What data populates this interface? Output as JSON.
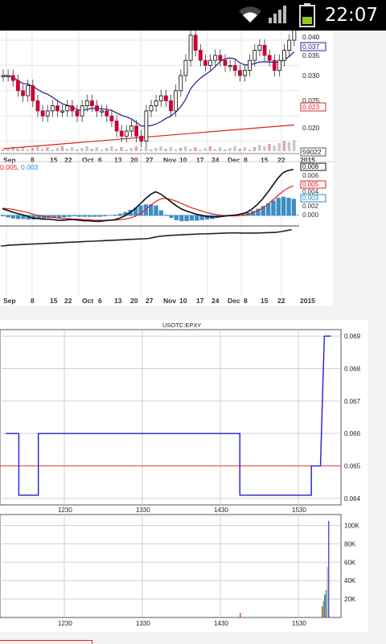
{
  "status_bar": {
    "time": "22:07",
    "icons": [
      "wifi-icon",
      "signal-icon",
      "battery-icon"
    ]
  },
  "chart_data": [
    {
      "type": "line",
      "subtype": "candlestick-with-moving-averages",
      "price_ticks": [
        "0.040",
        "0.035",
        "0.030",
        "0.025",
        "0.020"
      ],
      "last_price_labels": [
        "0.037",
        "0.023"
      ],
      "volume_label": "59022",
      "date_ticks": [
        "Sep",
        "8",
        "15",
        "22",
        "Oct",
        "6",
        "13",
        "20",
        "27",
        "Nov",
        "10",
        "17",
        "24",
        "Dec",
        "8",
        "15",
        "22",
        "2015"
      ],
      "colors": {
        "up": "#000000",
        "down": "#cc0033",
        "ma_short": "#1c1c8c",
        "ma_long": "#e02020"
      },
      "close": [
        0.033,
        0.033,
        0.032,
        0.03,
        0.029,
        0.031,
        0.028,
        0.026,
        0.025,
        0.026,
        0.027,
        0.026,
        0.026,
        0.027,
        0.026,
        0.025,
        0.027,
        0.028,
        0.027,
        0.026,
        0.026,
        0.025,
        0.024,
        0.022,
        0.021,
        0.022,
        0.023,
        0.021,
        0.02,
        0.026,
        0.027,
        0.028,
        0.029,
        0.028,
        0.026,
        0.03,
        0.033,
        0.036,
        0.041,
        0.038,
        0.036,
        0.035,
        0.036,
        0.037,
        0.036,
        0.035,
        0.035,
        0.034,
        0.033,
        0.034,
        0.036,
        0.038,
        0.039,
        0.037,
        0.036,
        0.034,
        0.036,
        0.038,
        0.04,
        0.043
      ]
    },
    {
      "type": "line",
      "subtype": "macd",
      "legend": [
        "0.005",
        "0.003"
      ],
      "value_labels": [
        "0.008",
        "0.006",
        "0.005",
        "0.004",
        "0.003",
        "0.002",
        "0.000"
      ],
      "ylim": [
        -0.0015,
        0.0085
      ],
      "macd": [
        0.0012,
        0.0009,
        0.0006,
        0.0003,
        0.0001,
        -0.0002,
        -0.0005,
        -0.0006,
        -0.0007,
        -0.0007,
        -0.0008,
        -0.0009,
        -0.0009,
        -0.0008,
        -0.0008,
        -0.0009,
        -0.001,
        -0.001,
        -0.0011,
        -0.0011,
        -0.001,
        -0.0009,
        -0.0008,
        -0.0005,
        -0.0001,
        0.0005,
        0.0012,
        0.0021,
        0.003,
        0.0038,
        0.0043,
        0.0039,
        0.0032,
        0.0025,
        0.0018,
        0.0012,
        0.0008,
        0.0005,
        0.0002,
        0.0,
        -0.0002,
        -0.0003,
        -0.0003,
        -0.0002,
        -0.0001,
        0.0,
        0.0001,
        0.0003,
        0.0006,
        0.0012,
        0.002,
        0.003,
        0.0042,
        0.0055,
        0.0068,
        0.0078,
        0.0082,
        0.0084
      ],
      "signal": [
        0.0013,
        0.0012,
        0.0011,
        0.0009,
        0.0007,
        0.0005,
        0.0002,
        0.0,
        -0.0002,
        -0.0003,
        -0.0004,
        -0.0005,
        -0.0006,
        -0.0006,
        -0.0007,
        -0.0007,
        -0.0008,
        -0.0008,
        -0.0009,
        -0.0009,
        -0.0009,
        -0.0009,
        -0.0009,
        -0.0008,
        -0.0007,
        -0.0005,
        -0.0002,
        0.0003,
        0.001,
        0.0018,
        0.0025,
        0.003,
        0.0031,
        0.0029,
        0.0026,
        0.0022,
        0.0018,
        0.0014,
        0.0011,
        0.0008,
        0.0005,
        0.0003,
        0.0001,
        0.0,
        -0.0001,
        -0.0001,
        -0.0001,
        0.0,
        0.0001,
        0.0004,
        0.0008,
        0.0013,
        0.002,
        0.0028,
        0.0036,
        0.0044,
        0.005,
        0.0054
      ]
    },
    {
      "type": "line",
      "subtype": "oscillator",
      "values": [
        0.21,
        0.215,
        0.22,
        0.222,
        0.225,
        0.228,
        0.23,
        0.232,
        0.235,
        0.238,
        0.24,
        0.242,
        0.245,
        0.248,
        0.25,
        0.252,
        0.255,
        0.258,
        0.26,
        0.262,
        0.265,
        0.268,
        0.27,
        0.272,
        0.275,
        0.278,
        0.28,
        0.282,
        0.285,
        0.288,
        0.3,
        0.31,
        0.315,
        0.32,
        0.322,
        0.325,
        0.328,
        0.33,
        0.332,
        0.335,
        0.336,
        0.338,
        0.34,
        0.342,
        0.344,
        0.346,
        0.346,
        0.345,
        0.344,
        0.344,
        0.345,
        0.346,
        0.348,
        0.35,
        0.352,
        0.36,
        0.37,
        0.38
      ]
    },
    {
      "type": "line",
      "subtype": "intraday-price",
      "title": "USOTC:EPXY",
      "y_ticks": [
        "0.069",
        "0.068",
        "0.067",
        "0.066",
        "0.065",
        "0.064"
      ],
      "x_ticks": [
        "1230",
        "1330",
        "1430",
        "1530"
      ],
      "ylim": [
        0.0638,
        0.0692
      ],
      "reference_value": 0.065,
      "price_series": [
        [
          1145,
          0.066
        ],
        [
          1155,
          0.066
        ],
        [
          1155,
          0.0641
        ],
        [
          1210,
          0.0641
        ],
        [
          1210,
          0.066
        ],
        [
          1445,
          0.066
        ],
        [
          1445,
          0.0641
        ],
        [
          1540,
          0.0641
        ],
        [
          1540,
          0.065
        ],
        [
          1547,
          0.065
        ],
        [
          1550,
          0.069
        ],
        [
          1555,
          0.069
        ]
      ],
      "colors": {
        "price": "#1e1ed6",
        "reference": "#e83b3b"
      }
    },
    {
      "type": "bar",
      "subtype": "intraday-volume",
      "y_ticks": [
        "100K",
        "80K",
        "60K",
        "40K",
        "20K"
      ],
      "x_ticks": [
        "1230",
        "1330",
        "1430",
        "1530"
      ],
      "ylim": [
        0,
        110000
      ],
      "bars": [
        [
          1445,
          5000
        ],
        [
          1548,
          12000
        ],
        [
          1549,
          18000
        ],
        [
          1550,
          25000
        ],
        [
          1551,
          30000
        ],
        [
          1552,
          55000
        ],
        [
          1553,
          105000
        ]
      ]
    }
  ]
}
